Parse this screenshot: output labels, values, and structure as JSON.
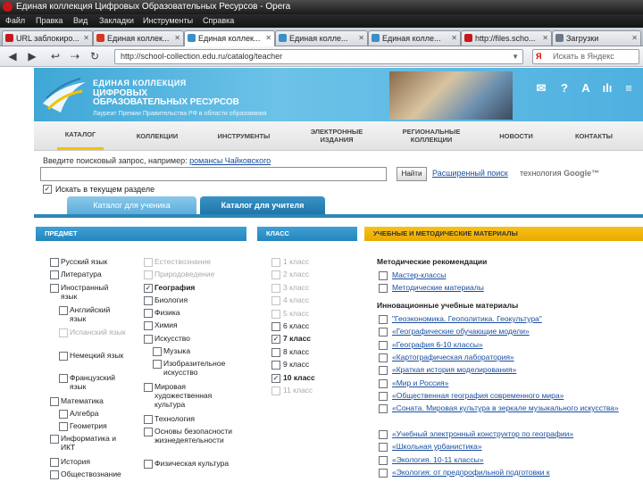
{
  "window": {
    "title": "Единая коллекция Цифровых Образовательных Ресурсов - Opera"
  },
  "menu": [
    "Файл",
    "Правка",
    "Вид",
    "Закладки",
    "Инструменты",
    "Справка"
  ],
  "tabs": [
    {
      "label": "URL заблокиро...",
      "fav": "#c8171a"
    },
    {
      "label": "Единая коллек...",
      "fav": "#d9361f"
    },
    {
      "label": "Единая коллек...",
      "fav": "#3a8fc8"
    },
    {
      "label": "Единая колле...",
      "fav": "#3a8fc8"
    },
    {
      "label": "Единая колле...",
      "fav": "#3a8fc8"
    },
    {
      "label": "http://files.scho...",
      "fav": "#c8171a"
    },
    {
      "label": "Загрузки",
      "fav": "#6a7a8a"
    }
  ],
  "address": {
    "url": "http://school-collection.edu.ru/catalog/teacher",
    "search_placeholder": "Искать в Яндекс",
    "search_brand": "Я"
  },
  "site": {
    "brand_line1": "ЕДИНАЯ КОЛЛЕКЦИЯ",
    "brand_line2a": "ЦИФРОВЫХ",
    "brand_line2b": "ОБРАЗОВАТЕЛЬНЫХ РЕСУРСОВ",
    "brand_line3": "Лауреат Премии Правительства РФ в области образования",
    "icons": [
      "✉",
      "?",
      "A",
      "ılı",
      "≡"
    ]
  },
  "nav": [
    "КАТАЛОГ",
    "КОЛЛЕКЦИИ",
    "ИНСТРУМЕНТЫ",
    "ЭЛЕКТРОННЫЕ ИЗДАНИЯ",
    "РЕГИОНАЛЬНЫЕ КОЛЛЕКЦИИ",
    "НОВОСТИ",
    "КОНТАКТЫ"
  ],
  "search": {
    "hint_prefix": "Введите поисковый запрос, например:",
    "hint_example": "романсы Чайковского",
    "button": "Найти",
    "advanced": "Расширенный поиск",
    "tech": "технология",
    "google": "Google™",
    "in_section": "Искать в текущем разделе"
  },
  "catalog_tabs": [
    "Каталог для ученика",
    "Каталог для учителя"
  ],
  "columns": {
    "subject": "ПРЕДМЕТ",
    "grade": "КЛАСС",
    "materials": "УЧЕБНЫЕ И МЕТОДИЧЕСКИЕ МАТЕРИАЛЫ"
  },
  "subjects_left": [
    {
      "label": "Русский язык",
      "indent": 0,
      "checkbox": true,
      "checked": false,
      "disabled": false
    },
    {
      "label": "Литература",
      "indent": 0,
      "checkbox": true,
      "checked": false,
      "disabled": false
    },
    {
      "label": "Иностранный язык",
      "indent": 0,
      "checkbox": true,
      "checked": false,
      "disabled": false
    },
    {
      "label": "Английский язык",
      "indent": 1,
      "checkbox": true,
      "checked": false,
      "disabled": false
    },
    {
      "label": "Испанский язык",
      "indent": 1,
      "checkbox": true,
      "checked": false,
      "disabled": true
    },
    {
      "label": "Немецкий язык",
      "indent": 1,
      "checkbox": true,
      "checked": false,
      "disabled": false
    },
    {
      "label": "Французский язык",
      "indent": 1,
      "checkbox": true,
      "checked": false,
      "disabled": false
    },
    {
      "label": "Математика",
      "indent": 0,
      "checkbox": true,
      "checked": false,
      "disabled": false
    },
    {
      "label": "Алгебра",
      "indent": 1,
      "checkbox": true,
      "checked": false,
      "disabled": false
    },
    {
      "label": "Геометрия",
      "indent": 1,
      "checkbox": true,
      "checked": false,
      "disabled": false
    },
    {
      "label": "Информатика и ИКТ",
      "indent": 0,
      "checkbox": true,
      "checked": false,
      "disabled": false
    },
    {
      "label": "История",
      "indent": 0,
      "checkbox": true,
      "checked": false,
      "disabled": false
    },
    {
      "label": "Обществознание",
      "indent": 0,
      "checkbox": true,
      "checked": false,
      "disabled": false
    }
  ],
  "subjects_right": [
    {
      "label": "Естествознание",
      "indent": 0,
      "checked": false,
      "disabled": true
    },
    {
      "label": "Природоведение",
      "indent": 0,
      "checked": false,
      "disabled": true
    },
    {
      "label": "География",
      "indent": 0,
      "checked": true,
      "disabled": false
    },
    {
      "label": "Биология",
      "indent": 0,
      "checked": false,
      "disabled": false
    },
    {
      "label": "Физика",
      "indent": 0,
      "checked": false,
      "disabled": false
    },
    {
      "label": "Химия",
      "indent": 0,
      "checked": false,
      "disabled": false
    },
    {
      "label": "Искусство",
      "indent": 0,
      "checked": false,
      "disabled": false
    },
    {
      "label": "Музыка",
      "indent": 1,
      "checked": false,
      "disabled": false
    },
    {
      "label": "Изобразительное искусство",
      "indent": 1,
      "checked": false,
      "disabled": false
    },
    {
      "label": "Мировая художественная культура",
      "indent": 0,
      "checked": false,
      "disabled": false
    },
    {
      "label": "Технология",
      "indent": 0,
      "checked": false,
      "disabled": false
    },
    {
      "label": "Основы безопасности жизнедеятельности",
      "indent": 0,
      "checked": false,
      "disabled": false
    },
    {
      "label": "Физическая культура",
      "indent": 0,
      "checked": false,
      "disabled": false
    }
  ],
  "grades": [
    {
      "label": "1 класс",
      "checked": false,
      "disabled": true
    },
    {
      "label": "2 класс",
      "checked": false,
      "disabled": true
    },
    {
      "label": "3 класс",
      "checked": false,
      "disabled": true
    },
    {
      "label": "4 класс",
      "checked": false,
      "disabled": true
    },
    {
      "label": "5 класс",
      "checked": false,
      "disabled": true
    },
    {
      "label": "6 класс",
      "checked": false,
      "disabled": false
    },
    {
      "label": "7 класс",
      "checked": true,
      "disabled": false
    },
    {
      "label": "8 класс",
      "checked": false,
      "disabled": false
    },
    {
      "label": "9 класс",
      "checked": false,
      "disabled": false
    },
    {
      "label": "10 класс",
      "checked": true,
      "disabled": false
    },
    {
      "label": "11 класс",
      "checked": false,
      "disabled": true
    }
  ],
  "materials": {
    "methodical_heading": "Методические рекомендации",
    "methodical": [
      "Мастер-классы",
      "Методические материалы"
    ],
    "innovative_heading": "Инновационные учебные материалы",
    "innovative": [
      "\"Геоэкономика. Геополитика. Геокультура\"",
      "«Географические обучающие модели»",
      "«География 6-10 классы»",
      "«Картографическая лаборатория»",
      "«Краткая история моделирования»",
      "«Мир и Россия»",
      "«Общественная география современного мира»",
      "«Соната. Мировая культура в зеркале музыкального искусства»",
      "«Учебный электронный конструктор по географии»",
      "«Школьная урбанистика»",
      "«Экология. 10-11 классы»",
      "«Экология: от предпрофильной подготовки к"
    ]
  }
}
